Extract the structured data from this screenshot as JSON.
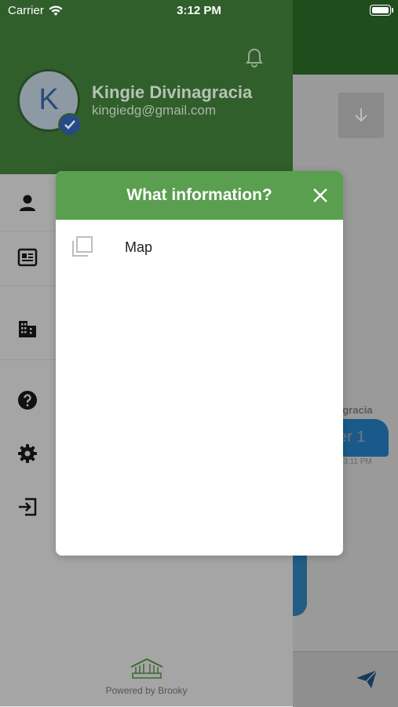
{
  "status_bar": {
    "carrier": "Carrier",
    "time": "3:12 PM"
  },
  "background": {
    "sender_fragment": "agracia",
    "bubble_fragment": "er 1",
    "bubble_time_fragment": "n 3:11 PM"
  },
  "drawer": {
    "avatar_initial": "K",
    "user_name": "Kingie Divinagracia",
    "user_email": "kingiedg@gmail.com",
    "menu_icons": [
      "person-icon",
      "id-card-icon",
      "building-icon",
      "help-icon",
      "settings-icon",
      "logout-icon"
    ],
    "footer_text": "Powered by Brooky"
  },
  "dialog": {
    "title": "What information?",
    "options": [
      {
        "label": "Map",
        "icon": "copy-icon"
      }
    ]
  },
  "colors": {
    "header_green": "#305f2b",
    "dialog_green": "#5a9e4f",
    "accent_blue": "#274a86"
  }
}
